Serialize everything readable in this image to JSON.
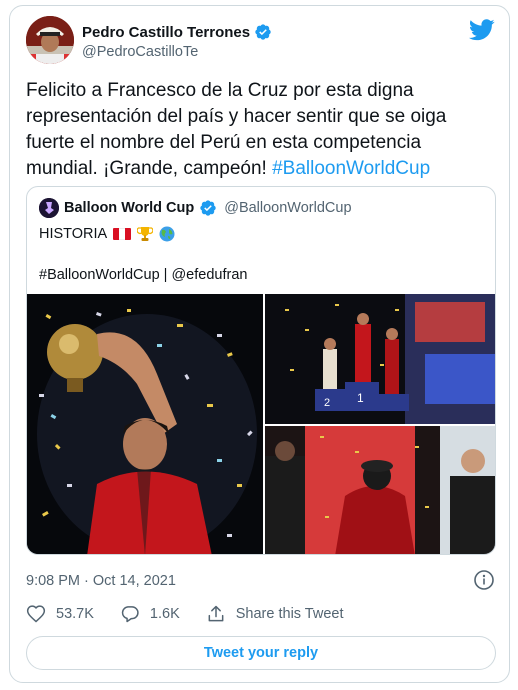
{
  "author": {
    "name": "Pedro Castillo Terrones",
    "handle": "@PedroCastilloTe",
    "verified": true
  },
  "tweet": {
    "text": "Felicito a Francesco de la Cruz por esta digna representación del país y hacer sentir que se oiga fuerte el nombre del Perú en esta competencia mundial. ¡Grande, campeón! ",
    "hashtag": "#BalloonWorldCup"
  },
  "quoted": {
    "name": "Balloon World Cup",
    "handle": "@BalloonWorldCup",
    "verified": true,
    "line1": "HISTORIA",
    "emojis": [
      "peru-flag",
      "trophy",
      "globe"
    ],
    "line2": "#BalloonWorldCup | @efedufran"
  },
  "meta": {
    "timestamp": "9:08 PM · Oct 14, 2021"
  },
  "actions": {
    "likes": "53.7K",
    "replies": "1.6K",
    "share_label": "Share this Tweet"
  },
  "reply_button": "Tweet your reply",
  "colors": {
    "accent": "#1d9bf0",
    "text": "#0f1419",
    "secondary": "#536471",
    "border": "#cfd9de"
  }
}
